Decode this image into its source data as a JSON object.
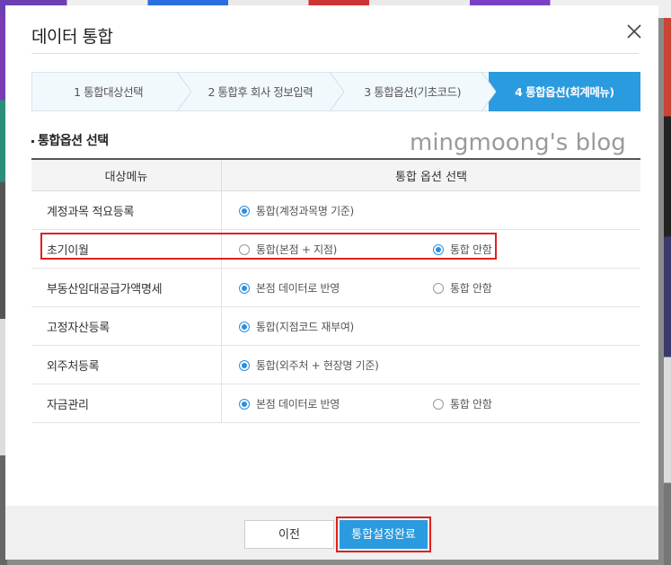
{
  "dialog": {
    "title": "데이터 통합",
    "close_icon": "close-icon"
  },
  "steps": [
    {
      "label": "1 통합대상선택",
      "active": false
    },
    {
      "label": "2 통합후 회사 정보입력",
      "active": false
    },
    {
      "label": "3 통합옵션(기초코드)",
      "active": false
    },
    {
      "label": "4 통합옵션(회계메뉴)",
      "active": true
    }
  ],
  "section": {
    "title": "통합옵션 선택",
    "watermark": "mingmoong's blog"
  },
  "table": {
    "headers": [
      "대상메뉴",
      "통합 옵션 선택"
    ],
    "rows": [
      {
        "menu": "계정과목 적요등록",
        "options": [
          {
            "label": "통합(계정과목명 기준)",
            "checked": true
          }
        ]
      },
      {
        "menu": "초기이월",
        "options": [
          {
            "label": "통합(본점 + 지점)",
            "checked": false
          },
          {
            "label": "통합 안함",
            "checked": true
          }
        ]
      },
      {
        "menu": "부동산임대공급가액명세",
        "options": [
          {
            "label": "본점 데이터로 반영",
            "checked": true
          },
          {
            "label": "통합 안함",
            "checked": false
          }
        ]
      },
      {
        "menu": "고정자산등록",
        "options": [
          {
            "label": "통합(지점코드 재부여)",
            "checked": true
          }
        ]
      },
      {
        "menu": "외주처등록",
        "options": [
          {
            "label": "통합(외주처 + 현장명 기준)",
            "checked": true
          }
        ]
      },
      {
        "menu": "자금관리",
        "options": [
          {
            "label": "본점 데이터로 반영",
            "checked": true
          },
          {
            "label": "통합 안함",
            "checked": false
          }
        ]
      }
    ]
  },
  "footer": {
    "prev_label": "이전",
    "complete_label": "통합설정완료"
  },
  "colors": {
    "accent": "#2b9be0",
    "highlight": "#e02020"
  }
}
